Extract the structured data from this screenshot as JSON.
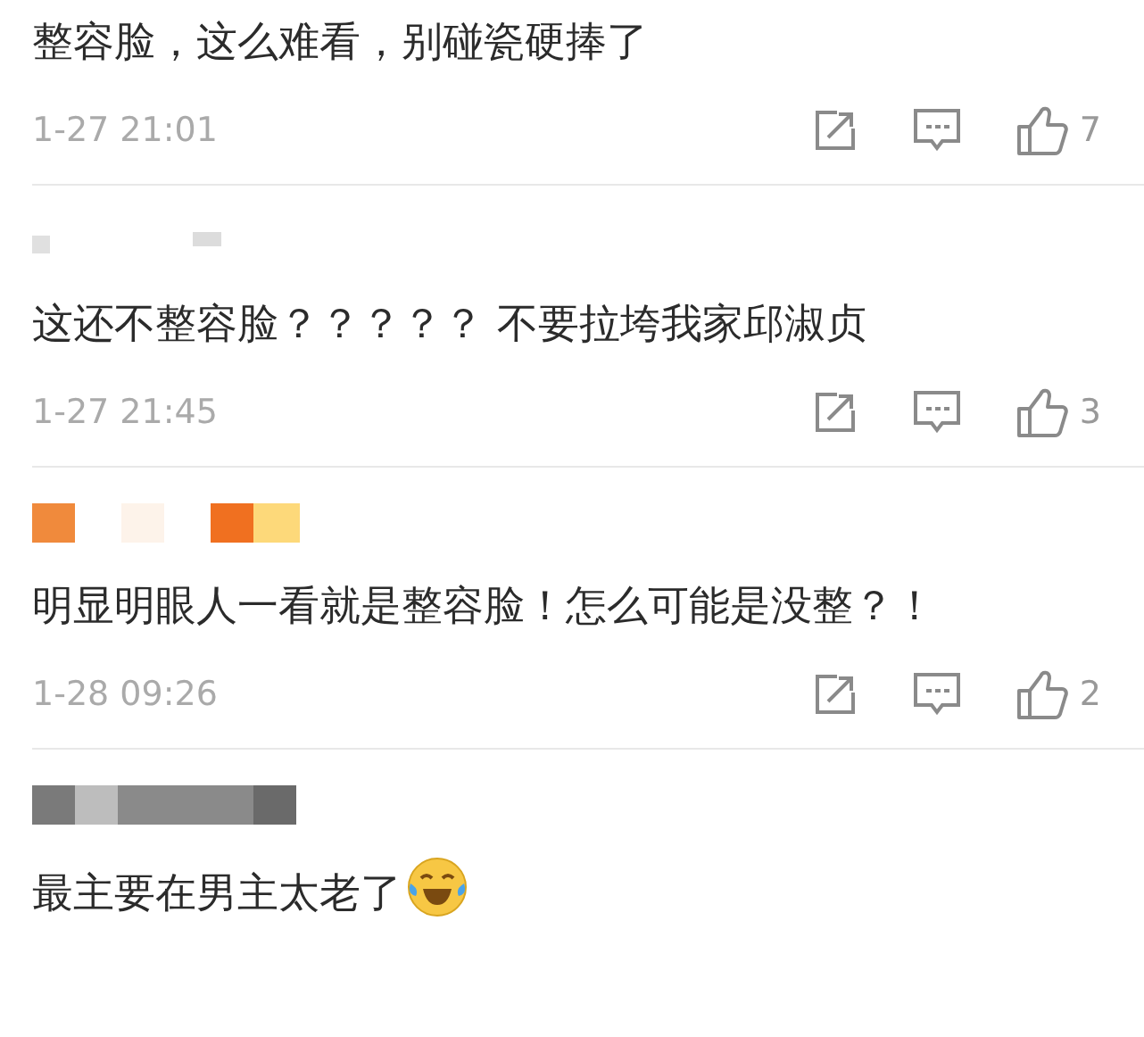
{
  "comments": [
    {
      "username": {
        "kind": "hidden"
      },
      "text": "整容脸，这么难看，别碰瓷硬捧了",
      "trailing_emoji": false,
      "time": "1-27 21:01",
      "likes": "7"
    },
    {
      "username": {
        "kind": "faint"
      },
      "text": "这还不整容脸？？？？？ 不要拉垮我家邱淑贞",
      "trailing_emoji": false,
      "time": "1-27 21:45",
      "likes": "3"
    },
    {
      "username": {
        "kind": "mosaic-orange"
      },
      "text": "明显明眼人一看就是整容脸！怎么可能是没整？！",
      "trailing_emoji": false,
      "time": "1-28 09:26",
      "likes": "2"
    },
    {
      "username": {
        "kind": "mosaic-grey"
      },
      "text": "最主要在男主太老了",
      "trailing_emoji": true
    }
  ]
}
